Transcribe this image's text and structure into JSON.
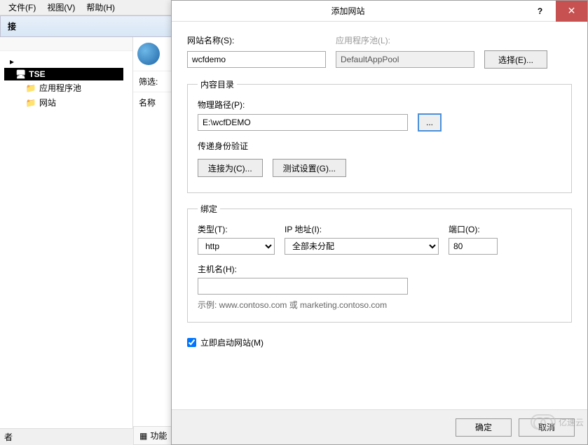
{
  "menu": {
    "file": "文件(F)",
    "view": "视图(V)",
    "help": "帮助(H)"
  },
  "leftPanel": {
    "header": "接"
  },
  "tree": {
    "root": "TSE",
    "appPool": "应用程序池",
    "sites": "网站"
  },
  "middle": {
    "filter": "筛选:",
    "name": "名称"
  },
  "bottomStatus": "者",
  "bottomTab": "功能",
  "dialog": {
    "title": "添加网站",
    "siteNameLabel": "网站名称(S):",
    "siteNameValue": "wcfdemo",
    "appPoolLabel": "应用程序池(L):",
    "appPoolValue": "DefaultAppPool",
    "selectBtn": "选择(E)...",
    "contentLegend": "内容目录",
    "physicalPathLabel": "物理路径(P):",
    "physicalPathValue": "E:\\wcfDEMO",
    "browseBtn": "...",
    "authLabel": "传递身份验证",
    "connectAsBtn": "连接为(C)...",
    "testSettingsBtn": "测试设置(G)...",
    "bindingLegend": "绑定",
    "typeLabel": "类型(T):",
    "typeValue": "http",
    "ipLabel": "IP 地址(I):",
    "ipValue": "全部未分配",
    "portLabel": "端口(O):",
    "portValue": "80",
    "hostnameLabel": "主机名(H):",
    "hostnameValue": "",
    "example": "示例: www.contoso.com 或 marketing.contoso.com",
    "startImmediately": "立即启动网站(M)",
    "okBtn": "确定",
    "cancelBtn": "取消"
  },
  "watermark": "亿速云"
}
